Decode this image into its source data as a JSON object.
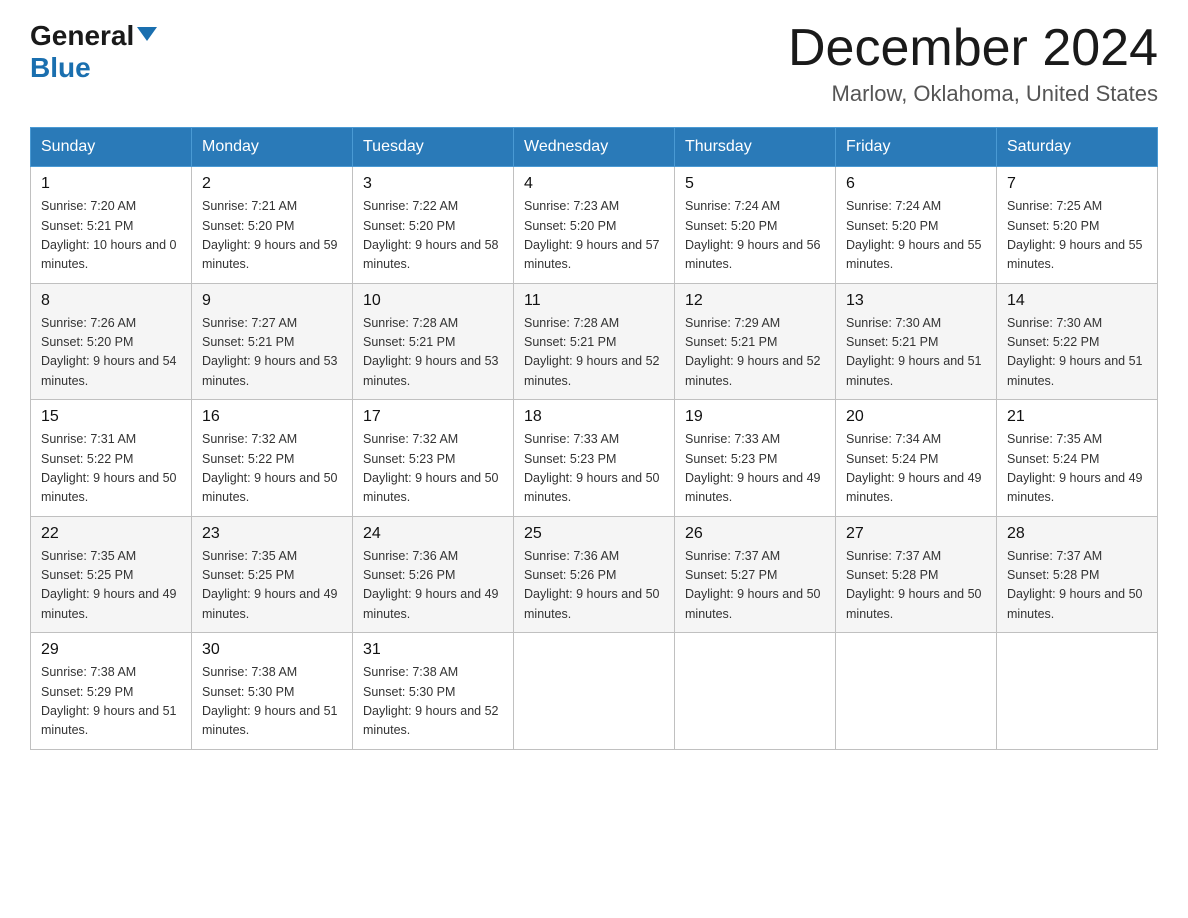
{
  "header": {
    "logo_general": "General",
    "logo_blue": "Blue",
    "month_title": "December 2024",
    "location": "Marlow, Oklahoma, United States"
  },
  "days_of_week": [
    "Sunday",
    "Monday",
    "Tuesday",
    "Wednesday",
    "Thursday",
    "Friday",
    "Saturday"
  ],
  "weeks": [
    [
      {
        "day": "1",
        "sunrise": "7:20 AM",
        "sunset": "5:21 PM",
        "daylight": "10 hours and 0 minutes."
      },
      {
        "day": "2",
        "sunrise": "7:21 AM",
        "sunset": "5:20 PM",
        "daylight": "9 hours and 59 minutes."
      },
      {
        "day": "3",
        "sunrise": "7:22 AM",
        "sunset": "5:20 PM",
        "daylight": "9 hours and 58 minutes."
      },
      {
        "day": "4",
        "sunrise": "7:23 AM",
        "sunset": "5:20 PM",
        "daylight": "9 hours and 57 minutes."
      },
      {
        "day": "5",
        "sunrise": "7:24 AM",
        "sunset": "5:20 PM",
        "daylight": "9 hours and 56 minutes."
      },
      {
        "day": "6",
        "sunrise": "7:24 AM",
        "sunset": "5:20 PM",
        "daylight": "9 hours and 55 minutes."
      },
      {
        "day": "7",
        "sunrise": "7:25 AM",
        "sunset": "5:20 PM",
        "daylight": "9 hours and 55 minutes."
      }
    ],
    [
      {
        "day": "8",
        "sunrise": "7:26 AM",
        "sunset": "5:20 PM",
        "daylight": "9 hours and 54 minutes."
      },
      {
        "day": "9",
        "sunrise": "7:27 AM",
        "sunset": "5:21 PM",
        "daylight": "9 hours and 53 minutes."
      },
      {
        "day": "10",
        "sunrise": "7:28 AM",
        "sunset": "5:21 PM",
        "daylight": "9 hours and 53 minutes."
      },
      {
        "day": "11",
        "sunrise": "7:28 AM",
        "sunset": "5:21 PM",
        "daylight": "9 hours and 52 minutes."
      },
      {
        "day": "12",
        "sunrise": "7:29 AM",
        "sunset": "5:21 PM",
        "daylight": "9 hours and 52 minutes."
      },
      {
        "day": "13",
        "sunrise": "7:30 AM",
        "sunset": "5:21 PM",
        "daylight": "9 hours and 51 minutes."
      },
      {
        "day": "14",
        "sunrise": "7:30 AM",
        "sunset": "5:22 PM",
        "daylight": "9 hours and 51 minutes."
      }
    ],
    [
      {
        "day": "15",
        "sunrise": "7:31 AM",
        "sunset": "5:22 PM",
        "daylight": "9 hours and 50 minutes."
      },
      {
        "day": "16",
        "sunrise": "7:32 AM",
        "sunset": "5:22 PM",
        "daylight": "9 hours and 50 minutes."
      },
      {
        "day": "17",
        "sunrise": "7:32 AM",
        "sunset": "5:23 PM",
        "daylight": "9 hours and 50 minutes."
      },
      {
        "day": "18",
        "sunrise": "7:33 AM",
        "sunset": "5:23 PM",
        "daylight": "9 hours and 50 minutes."
      },
      {
        "day": "19",
        "sunrise": "7:33 AM",
        "sunset": "5:23 PM",
        "daylight": "9 hours and 49 minutes."
      },
      {
        "day": "20",
        "sunrise": "7:34 AM",
        "sunset": "5:24 PM",
        "daylight": "9 hours and 49 minutes."
      },
      {
        "day": "21",
        "sunrise": "7:35 AM",
        "sunset": "5:24 PM",
        "daylight": "9 hours and 49 minutes."
      }
    ],
    [
      {
        "day": "22",
        "sunrise": "7:35 AM",
        "sunset": "5:25 PM",
        "daylight": "9 hours and 49 minutes."
      },
      {
        "day": "23",
        "sunrise": "7:35 AM",
        "sunset": "5:25 PM",
        "daylight": "9 hours and 49 minutes."
      },
      {
        "day": "24",
        "sunrise": "7:36 AM",
        "sunset": "5:26 PM",
        "daylight": "9 hours and 49 minutes."
      },
      {
        "day": "25",
        "sunrise": "7:36 AM",
        "sunset": "5:26 PM",
        "daylight": "9 hours and 50 minutes."
      },
      {
        "day": "26",
        "sunrise": "7:37 AM",
        "sunset": "5:27 PM",
        "daylight": "9 hours and 50 minutes."
      },
      {
        "day": "27",
        "sunrise": "7:37 AM",
        "sunset": "5:28 PM",
        "daylight": "9 hours and 50 minutes."
      },
      {
        "day": "28",
        "sunrise": "7:37 AM",
        "sunset": "5:28 PM",
        "daylight": "9 hours and 50 minutes."
      }
    ],
    [
      {
        "day": "29",
        "sunrise": "7:38 AM",
        "sunset": "5:29 PM",
        "daylight": "9 hours and 51 minutes."
      },
      {
        "day": "30",
        "sunrise": "7:38 AM",
        "sunset": "5:30 PM",
        "daylight": "9 hours and 51 minutes."
      },
      {
        "day": "31",
        "sunrise": "7:38 AM",
        "sunset": "5:30 PM",
        "daylight": "9 hours and 52 minutes."
      },
      null,
      null,
      null,
      null
    ]
  ]
}
